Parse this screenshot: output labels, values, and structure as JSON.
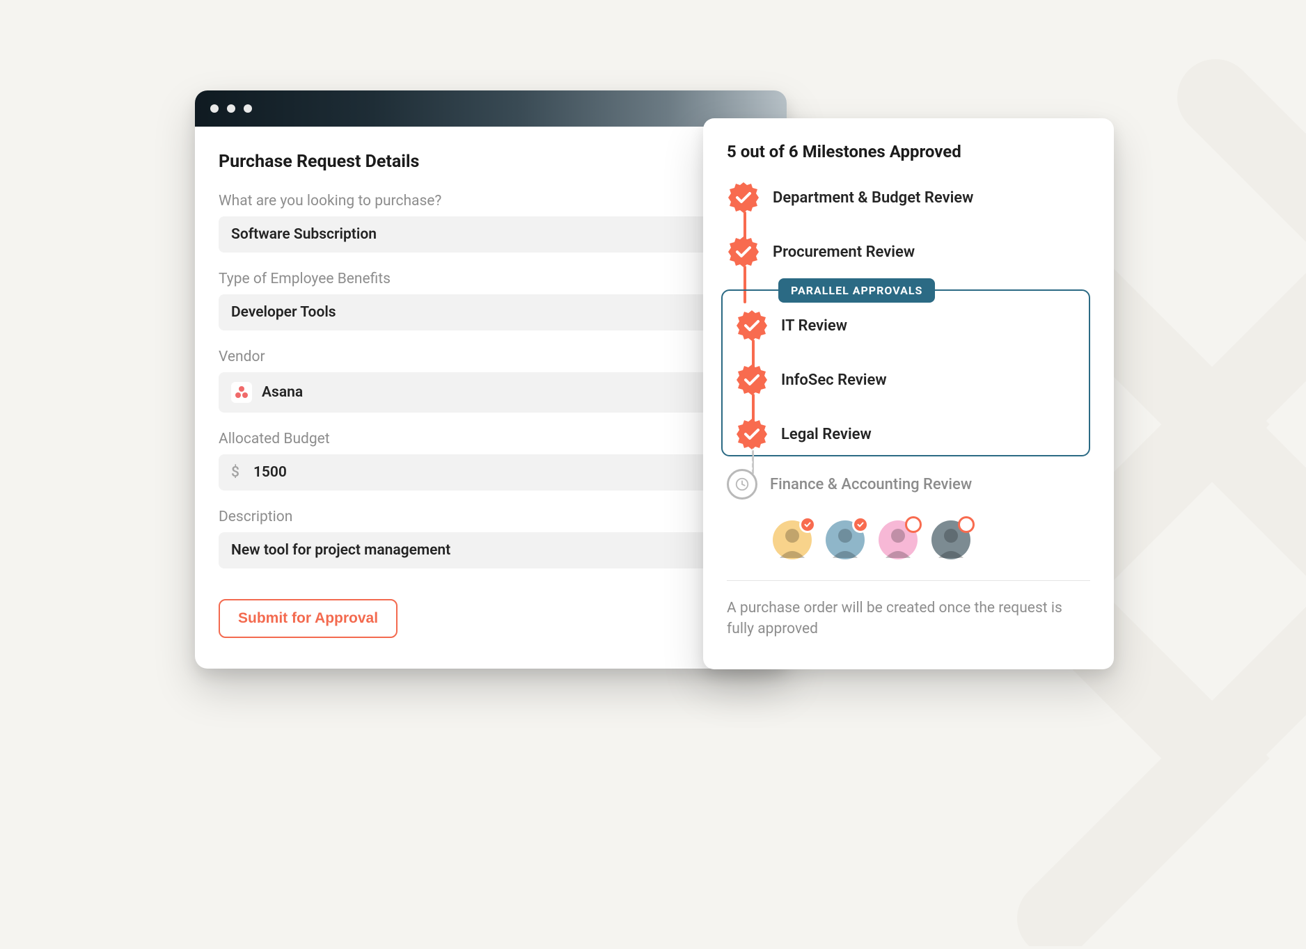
{
  "form": {
    "title": "Purchase Request Details",
    "fields": {
      "purchase": {
        "label": "What are you looking to purchase?",
        "value": "Software Subscription"
      },
      "benefits": {
        "label": "Type of Employee Benefits",
        "value": "Developer Tools"
      },
      "vendor": {
        "label": "Vendor",
        "value": "Asana"
      },
      "budget": {
        "label": "Allocated Budget",
        "currency": "$",
        "value": "1500"
      },
      "description": {
        "label": "Description",
        "value": "New tool for project management"
      }
    },
    "submit_label": "Submit for Approval"
  },
  "panel": {
    "title": "5 out of 6 Milestones Approved",
    "parallel_tag": "PARALLEL APPROVALS",
    "milestones": {
      "dept": {
        "label": "Department & Budget Review",
        "status": "approved"
      },
      "proc": {
        "label": "Procurement Review",
        "status": "approved"
      },
      "it": {
        "label": "IT Review",
        "status": "approved"
      },
      "infosec": {
        "label": "InfoSec Review",
        "status": "approved"
      },
      "legal": {
        "label": "Legal Review",
        "status": "approved"
      },
      "finance": {
        "label": "Finance & Accounting Review",
        "status": "pending"
      }
    },
    "approvers": [
      {
        "approved": true,
        "bg": "#f8d38b"
      },
      {
        "approved": true,
        "bg": "#8fb6c9"
      },
      {
        "approved": false,
        "bg": "#f7b8d6"
      },
      {
        "approved": false,
        "bg": "#7c8b92"
      }
    ],
    "footnote": "A purchase order will be created once the request is fully approved"
  }
}
